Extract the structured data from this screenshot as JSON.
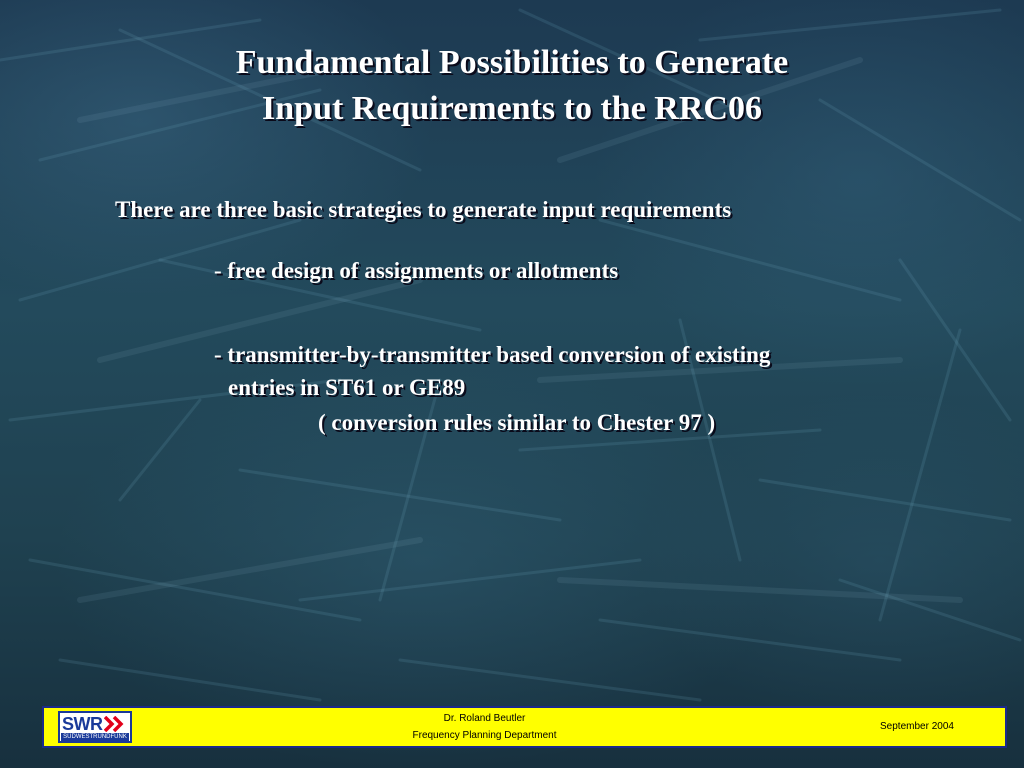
{
  "title": {
    "line1": "Fundamental Possibilities to Generate",
    "line2": "Input Requirements to the RRC06"
  },
  "intro": "There are three basic strategies to generate input requirements",
  "bullets": {
    "b1": "- free design of assignments or allotments",
    "b2_line1": "- transmitter-by-transmitter based conversion of existing",
    "b2_line2": "entries in ST61 or GE89",
    "b2_line3": "( conversion rules similar to Chester 97 )"
  },
  "footer": {
    "logo_text": "SWR",
    "logo_subtext": "SÜDWESTRUNDFUNK",
    "author": "Dr. Roland Beutler",
    "department": "Frequency Planning Department",
    "date": "September 2004",
    "bar_color": "#ffff00",
    "logo_color": "#1a3a9a",
    "logo_chevron_color": "#e2001a"
  },
  "colors": {
    "background": "#234a5c",
    "text": "#ffffff"
  }
}
